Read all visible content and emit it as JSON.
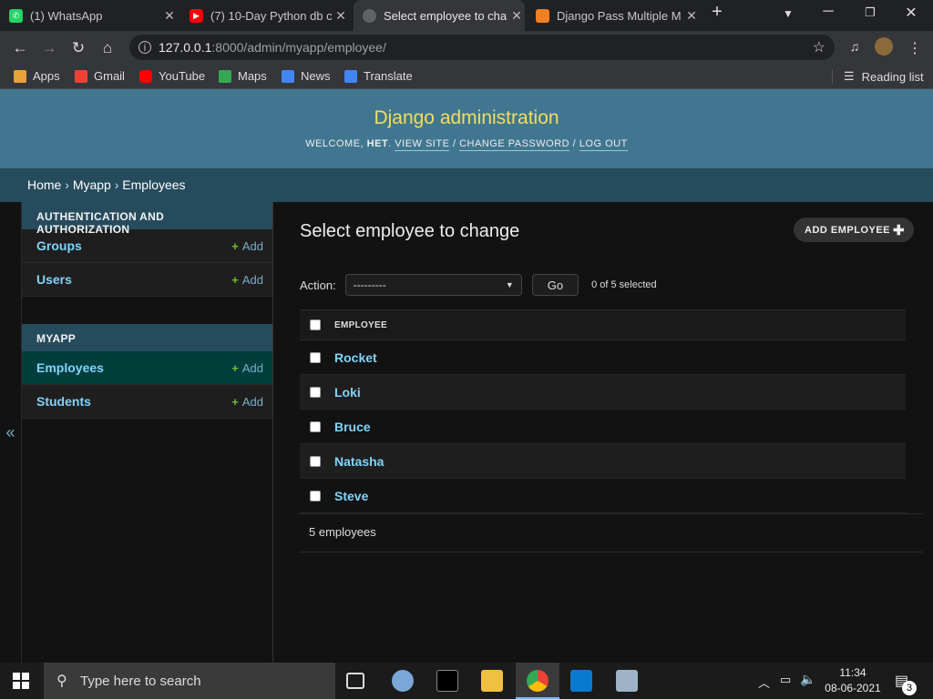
{
  "browser": {
    "tabs": [
      {
        "title": "(1) WhatsApp",
        "icon": "whatsapp-icon",
        "color": "#25d366"
      },
      {
        "title": "(7) 10-Day Python db c",
        "icon": "youtube-icon",
        "color": "#ff0000"
      },
      {
        "title": "Select employee to cha",
        "icon": "globe-icon",
        "color": "#9aa0a6"
      },
      {
        "title": "Django Pass Multiple M",
        "icon": "stackoverflow-icon",
        "color": "#f48024"
      }
    ],
    "url_host": "127.0.0.1",
    "url_path": ":8000/admin/myapp/employee/",
    "bookmarks": [
      {
        "label": "Apps",
        "icon": "apps-grid-icon",
        "color": "#e8a23b"
      },
      {
        "label": "Gmail",
        "icon": "gmail-icon",
        "color": "#ea4335"
      },
      {
        "label": "YouTube",
        "icon": "youtube-icon",
        "color": "#ff0000"
      },
      {
        "label": "Maps",
        "icon": "maps-icon",
        "color": "#34a853"
      },
      {
        "label": "News",
        "icon": "news-icon",
        "color": "#4285f4"
      },
      {
        "label": "Translate",
        "icon": "translate-icon",
        "color": "#4285f4"
      }
    ],
    "reading_list": "Reading list"
  },
  "header": {
    "site_name": "Django administration",
    "welcome": "Welcome,",
    "user": "Het",
    "view_site": "View site",
    "change_password": "Change password",
    "log_out": "Log out",
    "sep": "/"
  },
  "breadcrumbs": {
    "home": "Home",
    "app": "Myapp",
    "model": "Employees",
    "sep": "›"
  },
  "sidebar": {
    "toggle": "«",
    "add_label": "Add",
    "modules": [
      {
        "caption": "Authentication and Authorization",
        "models": [
          {
            "name": "Groups"
          },
          {
            "name": "Users"
          }
        ]
      },
      {
        "caption": "Myapp",
        "models": [
          {
            "name": "Employees"
          },
          {
            "name": "Students"
          }
        ]
      }
    ]
  },
  "content": {
    "title": "Select employee to change",
    "add_button": "ADD EMPLOYEE",
    "action_label": "Action:",
    "action_selected": "---------",
    "go_label": "Go",
    "counter": "0 of 5 selected",
    "column_header": "EMPLOYEE",
    "rows": [
      "Rocket",
      "Loki",
      "Bruce",
      "Natasha",
      "Steve"
    ],
    "paginator": "5 employees"
  },
  "taskbar": {
    "search_placeholder": "Type here to search",
    "time": "11:34",
    "date": "08-06-2021",
    "notifications": "3"
  },
  "colors": {
    "header_bg": "#417690",
    "site_name": "#f5dd5d",
    "breadcrumbs_bg": "#264b5d",
    "link": "#81d4fa",
    "add_green": "#70bf2b"
  }
}
